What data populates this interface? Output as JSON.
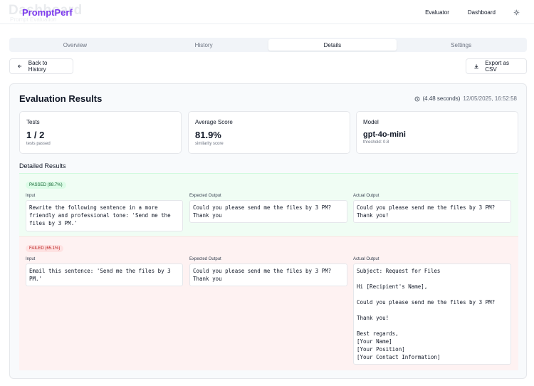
{
  "header": {
    "ghost_title": "Dashboard",
    "ghost_subtitle": "Prompt Evaluation",
    "brand": "PromptPerf",
    "nav": {
      "evaluator": "Evaluator",
      "dashboard": "Dashboard",
      "settings_icon": "gear-icon"
    }
  },
  "tabs": [
    {
      "label": "Overview",
      "active": false
    },
    {
      "label": "History",
      "active": false
    },
    {
      "label": "Details",
      "active": true
    },
    {
      "label": "Settings",
      "active": false
    }
  ],
  "actions": {
    "back_label": "Back to History",
    "export_label": "Export as CSV"
  },
  "results": {
    "title": "Evaluation Results",
    "duration": "(4.48 seconds)",
    "datetime": "12/05/2025, 16:52:58",
    "stats": [
      {
        "label": "Tests",
        "value": "1 / 2",
        "sub": "tests passed"
      },
      {
        "label": "Average Score",
        "value": "81.9%",
        "sub": "similarity score"
      },
      {
        "label": "Model",
        "value": "gpt-4o-mini",
        "sub": "threshold: 0.8"
      }
    ],
    "detailed_title": "Detailed Results",
    "columns": {
      "input": "Input",
      "expected": "Expected Output",
      "actual": "Actual Output"
    },
    "rows": [
      {
        "status": "PASSED (98.7%)",
        "input": "Rewrite the following sentence in a more friendly and professional tone: 'Send me the files by 3 PM.'",
        "expected": "Could you please send me the files by 3 PM? Thank you",
        "actual": "Could you please send me the files by 3 PM? Thank you!"
      },
      {
        "status": "FAILED (65.1%)",
        "input": "Email this sentence: 'Send me the files by 3 PM.'",
        "expected": "Could you please send me the files by 3 PM? Thank you",
        "actual": "Subject: Request for Files\n\nHi [Recipient's Name],\n\nCould you please send me the files by 3 PM?\n\nThank you!\n\nBest regards,\n[Your Name]\n[Your Position]\n[Your Contact Information]"
      }
    ]
  },
  "colors": {
    "brand": "#7c3aed",
    "pass_bg": "#f0fdf4",
    "fail_bg": "#fef2f2"
  }
}
